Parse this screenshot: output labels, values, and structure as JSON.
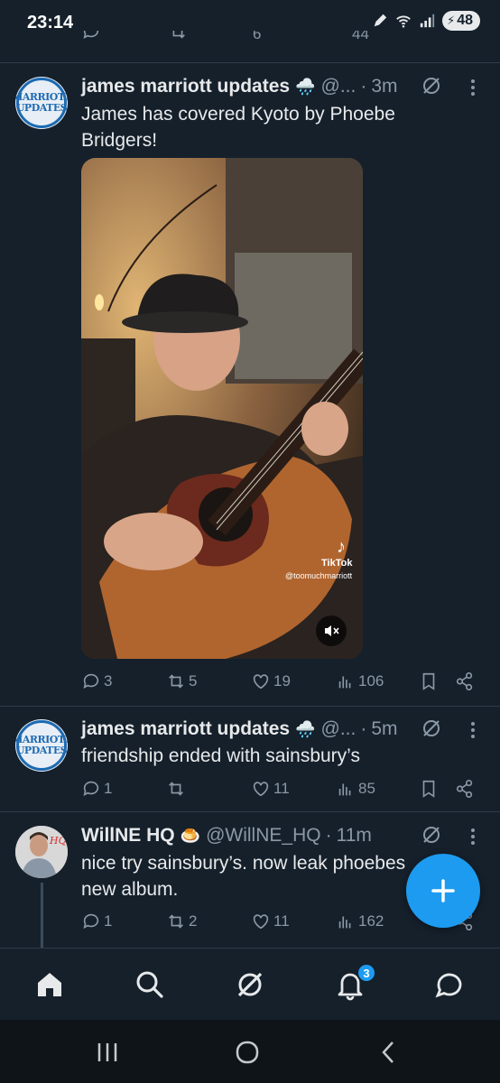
{
  "status_bar": {
    "time": "23:14",
    "battery": "48"
  },
  "partial_top": {
    "views": "44",
    "likes": "6"
  },
  "tweets": [
    {
      "name": "james marriott updates",
      "emoji": "🌧️",
      "handle": "@...",
      "time": "3m",
      "text": "James has covered Kyoto by Phoebe Bridgers!",
      "avatar_text": [
        "MARRIOTT",
        "UPDATES"
      ],
      "media": {
        "watermark_brand": "TikTok",
        "watermark_handle": "@toomuchmarriott",
        "muted": true
      },
      "stats": {
        "replies": "3",
        "reposts": "5",
        "likes": "19",
        "views": "106"
      }
    },
    {
      "name": "james marriott updates",
      "emoji": "🌧️",
      "handle": "@...",
      "time": "5m",
      "text": "friendship ended with sainsbury’s",
      "avatar_text": [
        "MARRIOTT",
        "UPDATES"
      ],
      "stats": {
        "replies": "1",
        "reposts": "",
        "likes": "11",
        "views": "85"
      }
    },
    {
      "name": "WillNE HQ",
      "emoji": "🍮",
      "handle": "@WillNE_HQ",
      "time": "11m",
      "text": "nice try sainsbury’s. now leak phoebes new album.",
      "stats": {
        "replies": "1",
        "reposts": "2",
        "likes": "11",
        "views": "162"
      }
    }
  ],
  "bottom_nav": {
    "items": [
      "home-icon",
      "search-icon",
      "grok-icon",
      "notifications-icon",
      "messages-icon"
    ],
    "notification_count": "3"
  },
  "colors": {
    "background": "#15202b",
    "accent": "#1d9bf0",
    "muted": "#8b98a5"
  }
}
